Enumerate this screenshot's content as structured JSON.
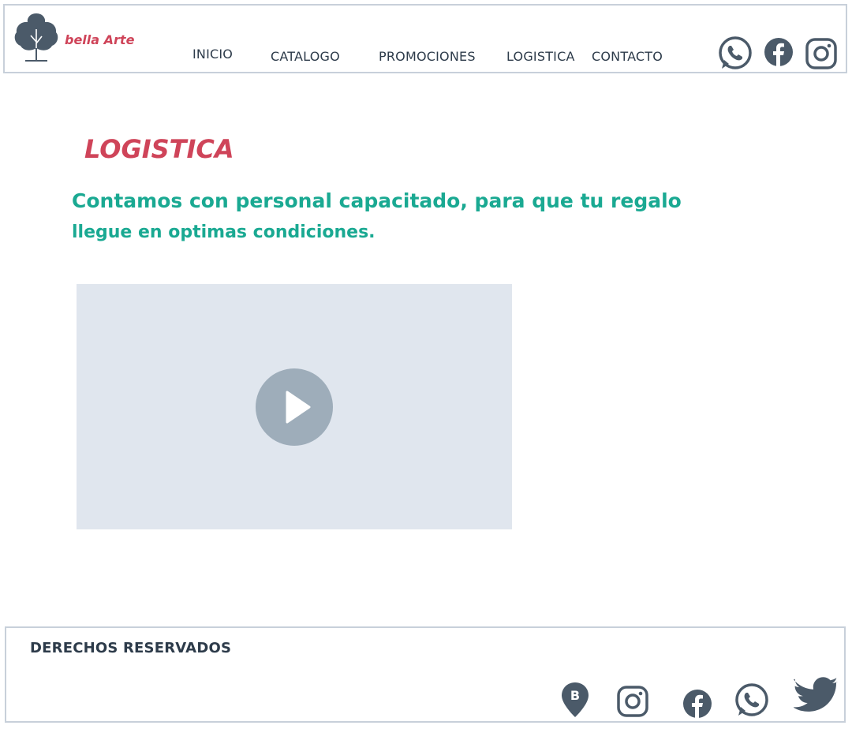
{
  "header": {
    "brand": "bella Arte",
    "logo_icon": "tree-icon",
    "nav": [
      {
        "label": "INICIO"
      },
      {
        "label": "CATALOGO"
      },
      {
        "label": "PROMOCIONES"
      },
      {
        "label": "LOGISTICA"
      },
      {
        "label": "CONTACTO"
      }
    ],
    "social_icons": [
      "whatsapp-icon",
      "facebook-icon",
      "instagram-icon"
    ]
  },
  "main": {
    "title": "LOGISTICA",
    "subtitle_line1": "Contamos con personal capacitado, para que tu regalo",
    "subtitle_line2": "llegue en optimas condiciones.",
    "video_icon": "play-icon"
  },
  "footer": {
    "rights": "DERECHOS RESERVADOS",
    "social_icons": [
      "map-pin-b-icon",
      "instagram-icon",
      "facebook-icon",
      "whatsapp-icon",
      "twitter-icon"
    ]
  },
  "colors": {
    "accent_red": "#cf4459",
    "accent_teal": "#1aa992",
    "icon_dark": "#4b5a69",
    "video_bg": "#e0e6ee",
    "play_bg": "#9eadba"
  }
}
